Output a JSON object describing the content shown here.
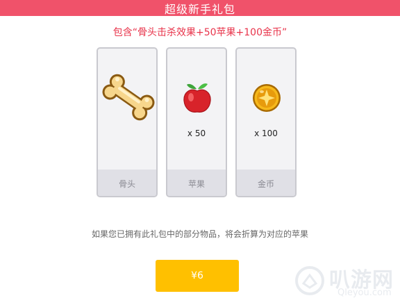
{
  "header": {
    "title": "超级新手礼包"
  },
  "subtitle": "包含“骨头击杀效果+50苹果+100金币”",
  "items": [
    {
      "name": "骨头",
      "quantity": "",
      "icon": "bone-icon"
    },
    {
      "name": "苹果",
      "quantity": "x 50",
      "icon": "apple-icon"
    },
    {
      "name": "金币",
      "quantity": "x 100",
      "icon": "coin-icon"
    }
  ],
  "notice": "如果您已拥有此礼包中的部分物品，将会折算为对应的苹果",
  "buy_button": {
    "label": "¥6"
  },
  "watermark": {
    "cn": "叭游网",
    "en": "Qleyou.com"
  },
  "colors": {
    "header": "#f0526a",
    "subtitle": "#e8334a",
    "button": "#ffc000",
    "card_border": "#c9c9cf",
    "card_footer": "#e0e0e6"
  }
}
